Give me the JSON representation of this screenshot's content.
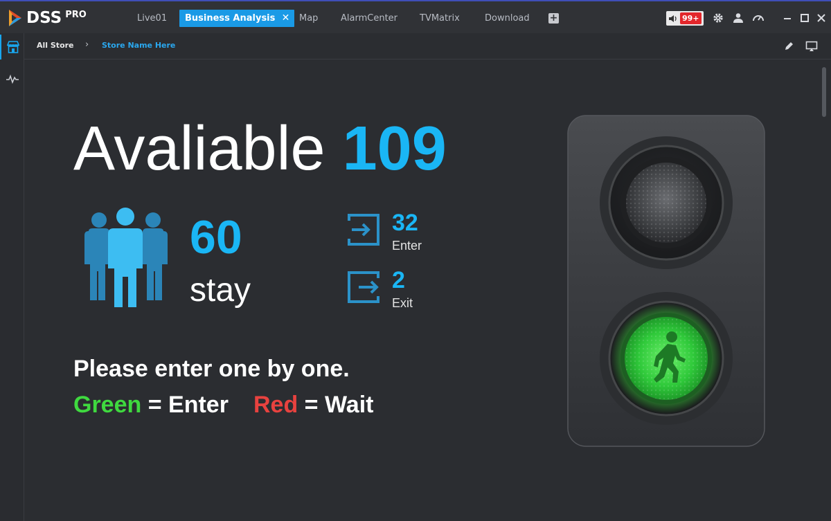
{
  "app": {
    "logo_text": "DSS",
    "logo_suffix": "PRO"
  },
  "tabs": [
    {
      "label": "Live01",
      "active": false
    },
    {
      "label": "Business Analysis",
      "active": true
    },
    {
      "label": "Map",
      "active": false
    },
    {
      "label": "AlarmCenter",
      "active": false
    },
    {
      "label": "TVMatrix",
      "active": false
    },
    {
      "label": "Download",
      "active": false
    }
  ],
  "tab_close_glyph": "✕",
  "tab_add_glyph": "+",
  "toolbar": {
    "alarm_badge": "99+",
    "icons": [
      "speaker-icon",
      "gear-icon",
      "user-icon",
      "speedometer-icon",
      "minimize-icon",
      "maximize-icon",
      "close-icon"
    ]
  },
  "leftrail": {
    "items": [
      {
        "icon": "store-icon",
        "active": true
      },
      {
        "icon": "pulse-icon",
        "active": false
      }
    ]
  },
  "breadcrumb": {
    "root": "All Store",
    "separator": "›",
    "current": "Store Name Here"
  },
  "dashboard": {
    "available_label": "Avaliable",
    "available_count": "109",
    "stay_count": "60",
    "stay_label": "stay",
    "enter_count": "32",
    "enter_label": "Enter",
    "exit_count": "2",
    "exit_label": "Exit",
    "notice": "Please enter one by one.",
    "legend_green_word": "Green",
    "legend_green_rest": " = Enter",
    "legend_red_word": "Red",
    "legend_red_rest": " = Wait",
    "signal_state": "green"
  },
  "colors": {
    "accent": "#1ab6f5",
    "tab_active": "#1a9ae6",
    "green": "#3fd93f",
    "red": "#e8423f",
    "badge": "#e3262b"
  }
}
